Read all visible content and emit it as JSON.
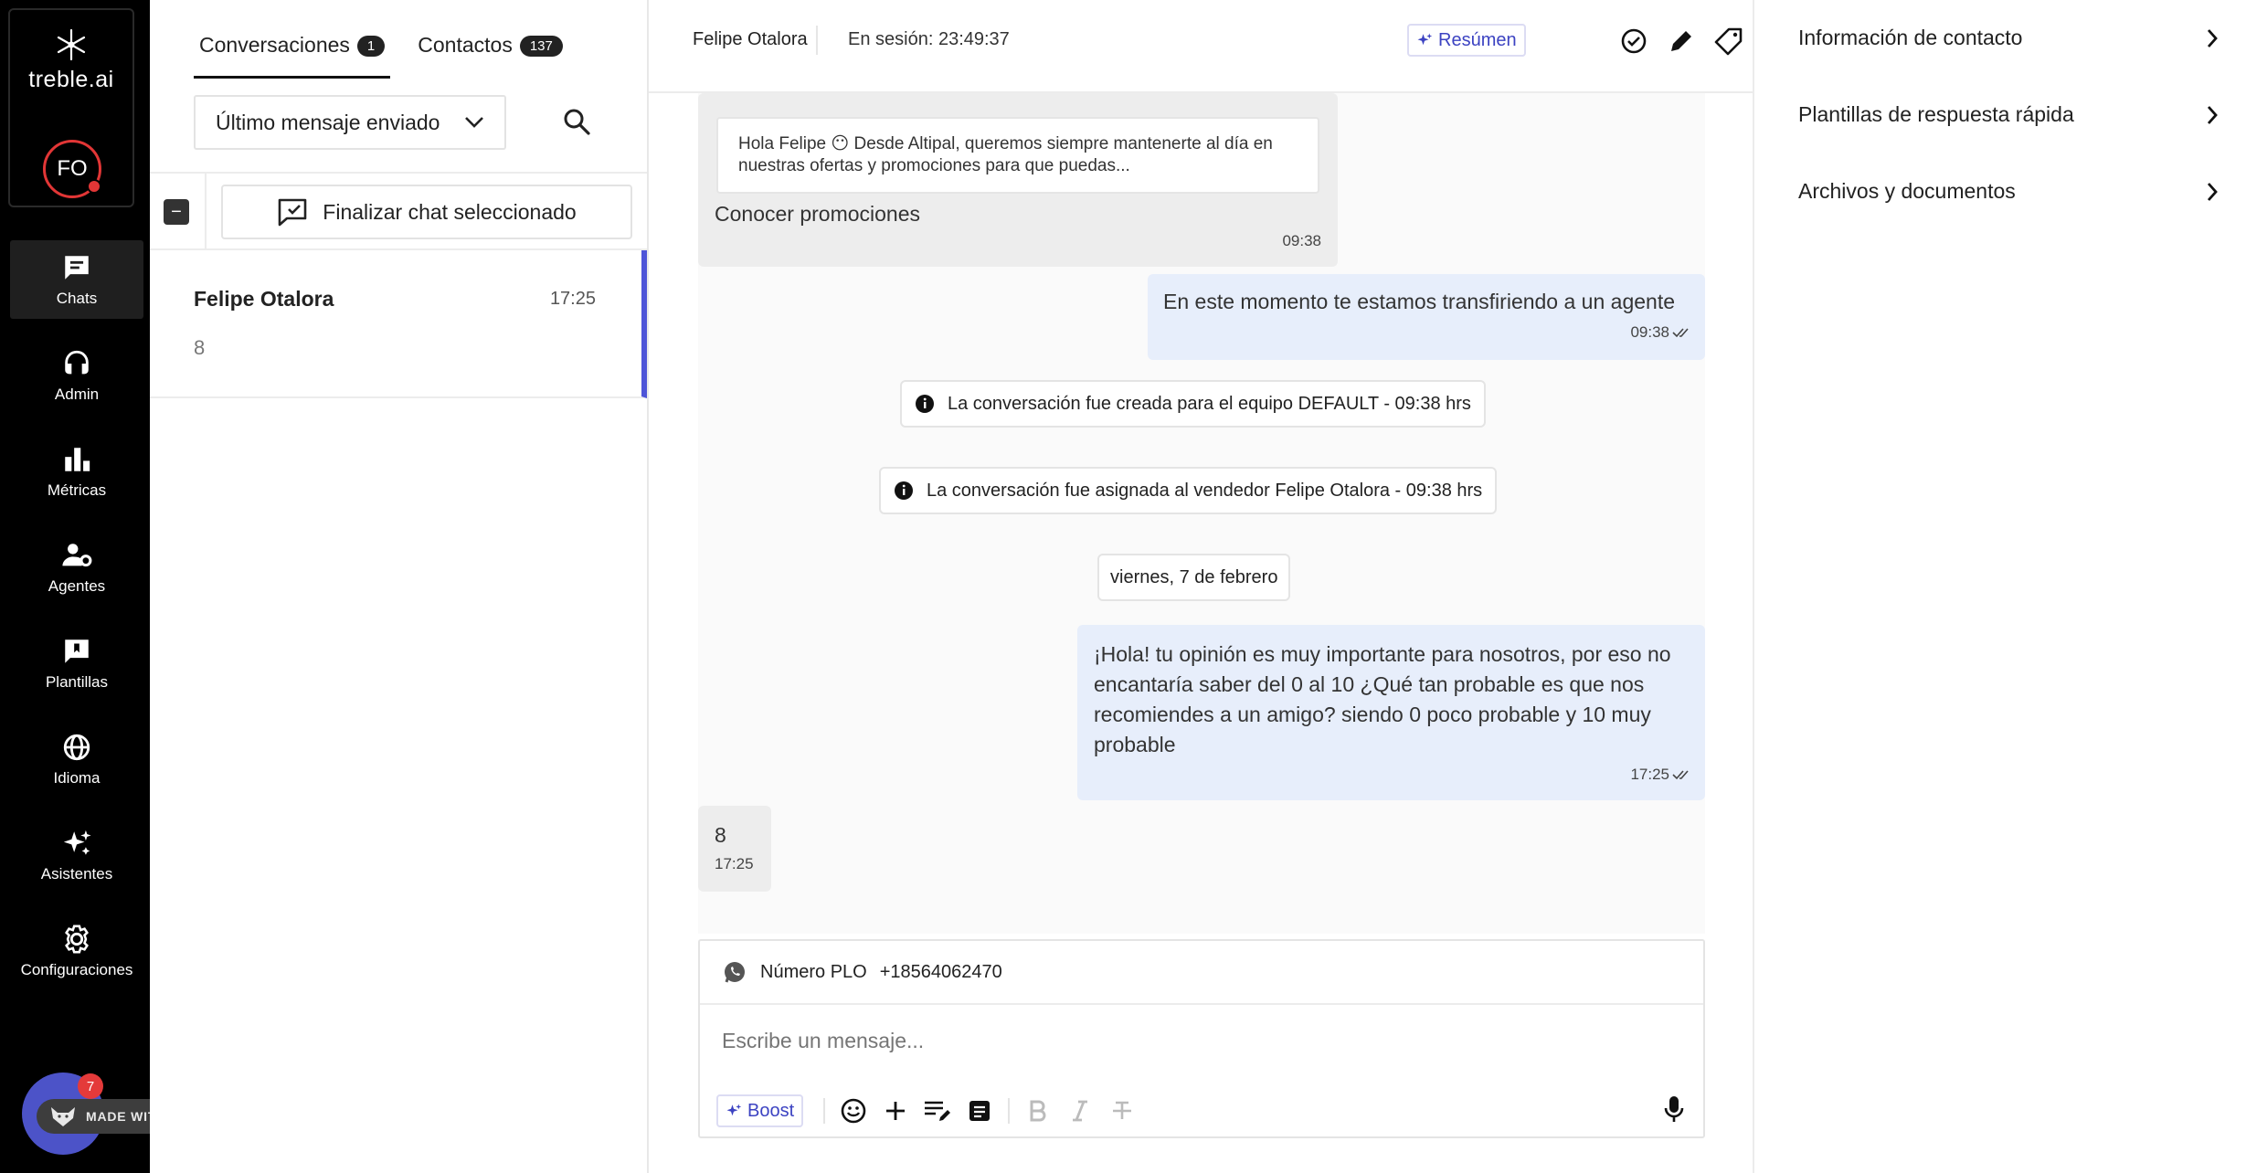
{
  "brand": {
    "name": "treble.ai"
  },
  "user": {
    "initials": "FO"
  },
  "nav": {
    "items": [
      {
        "label": "Chats",
        "icon": "chat-icon",
        "active": true
      },
      {
        "label": "Admin",
        "icon": "headset-icon"
      },
      {
        "label": "Métricas",
        "icon": "bar-chart-icon"
      },
      {
        "label": "Agentes",
        "icon": "agents-gear-icon"
      },
      {
        "label": "Plantillas",
        "icon": "template-icon"
      },
      {
        "label": "Idioma",
        "icon": "globe-icon"
      },
      {
        "label": "Asistentes",
        "icon": "sparkles-icon"
      },
      {
        "label": "Configuraciones",
        "icon": "gear-icon"
      }
    ]
  },
  "gifox": {
    "badge": "7",
    "label": "MADE WITH GIFOX"
  },
  "list": {
    "tabs": [
      {
        "label": "Conversaciones",
        "count": "1",
        "active": true
      },
      {
        "label": "Contactos",
        "count": "137"
      }
    ],
    "filter": {
      "selected": "Último mensaje enviado"
    },
    "bulk": {
      "check_symbol": "−",
      "end_chat_label": "Finalizar chat seleccionado"
    },
    "chats": [
      {
        "name": "Felipe Otalora",
        "time": "17:25",
        "preview": "8"
      }
    ]
  },
  "header": {
    "contact_name": "Felipe Otalora",
    "session": "En sesión: 23:49:37",
    "resumen_label": "Resúmen"
  },
  "messages": {
    "quoted_text": "Hola Felipe 😶 Desde Altipal, queremos siempre mantenerte al día en nuestras ofertas y promociones para que puedas...",
    "msg1_text": "Conocer promociones",
    "msg1_time": "09:38",
    "msg2_text": "En este momento te estamos transfiriendo a un agente",
    "msg2_time": "09:38",
    "sys1": "La conversación fue creada para el equipo DEFAULT - 09:38 hrs",
    "sys2": "La conversación fue asignada al vendedor Felipe Otalora - 09:38 hrs",
    "date": "viernes, 7 de febrero",
    "msg3_text": "¡Hola! tu opinión es muy importante para nosotros, por eso no encantaría saber del 0 al 10 ¿Qué tan probable es que nos recomiendes a un amigo? siendo 0 poco probable y 10 muy probable",
    "msg3_time": "17:25",
    "msg4_text": "8",
    "msg4_time": "17:25"
  },
  "composer": {
    "channel_label": "Número PLO",
    "channel_number": "+18564062470",
    "placeholder": "Escribe un mensaje...",
    "boost_label": "Boost"
  },
  "info": {
    "items": [
      {
        "label": "Información de contacto"
      },
      {
        "label": "Plantillas de respuesta rápida"
      },
      {
        "label": "Archivos y documentos"
      }
    ]
  },
  "colors": {
    "accent": "#4e55d8",
    "outgoing_bubble": "#e7eefb",
    "incoming_bubble": "#ededed",
    "avatar_ring": "#e23636"
  }
}
